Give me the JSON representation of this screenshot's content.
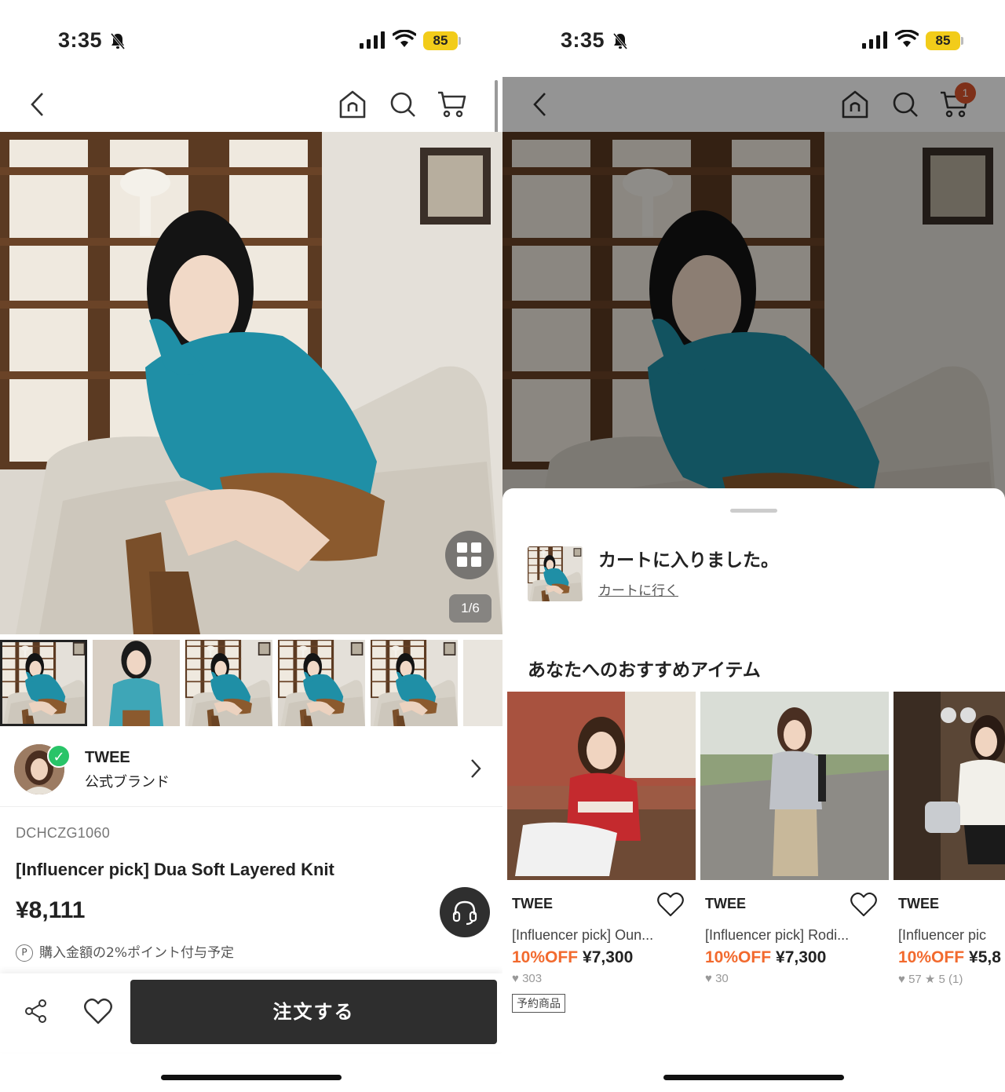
{
  "status": {
    "time": "3:35",
    "battery": "85"
  },
  "nav": {
    "cart_count": "1"
  },
  "product": {
    "image_counter": "1/6",
    "brand_name": "TWEE",
    "brand_sub": "公式ブランド",
    "sku": "DCHCZG1060",
    "title": "[Influencer pick] Dua Soft Layered Knit",
    "price": "¥8,111",
    "points_icon": "P",
    "points_text": "購入金額の2%ポイント付与予定",
    "order_label": "注文する"
  },
  "cart_sheet": {
    "added_message": "カートに入りました。",
    "go_to_cart": "カートに行く",
    "recommend_title": "あなたへのおすすめアイテム"
  },
  "recommendations": [
    {
      "brand": "TWEE",
      "name": "[Influencer pick] Oun...",
      "discount": "10%OFF",
      "price": "¥7,300",
      "meta": "♥ 303",
      "tag": "予約商品"
    },
    {
      "brand": "TWEE",
      "name": "[Influencer pick] Rodi...",
      "discount": "10%OFF",
      "price": "¥7,300",
      "meta": "♥ 30",
      "tag": ""
    },
    {
      "brand": "TWEE",
      "name": "[Influencer pic",
      "discount": "10%OFF",
      "price": "¥5,8",
      "meta": "♥ 57 ★ 5 (1)",
      "tag": ""
    }
  ],
  "colors": {
    "accent_orange": "#f26a2e",
    "verified_green": "#29c468",
    "battery_yellow": "#f2cc1a",
    "badge_red": "#d9532b",
    "button_dark": "#2e2e2e"
  },
  "icons": [
    "back-icon",
    "home-icon",
    "search-icon",
    "cart-icon",
    "grid-icon",
    "headset-icon",
    "share-icon",
    "heart-icon",
    "chevron-right-icon",
    "check-icon",
    "bell-slash-icon",
    "signal-icon",
    "wifi-icon"
  ]
}
